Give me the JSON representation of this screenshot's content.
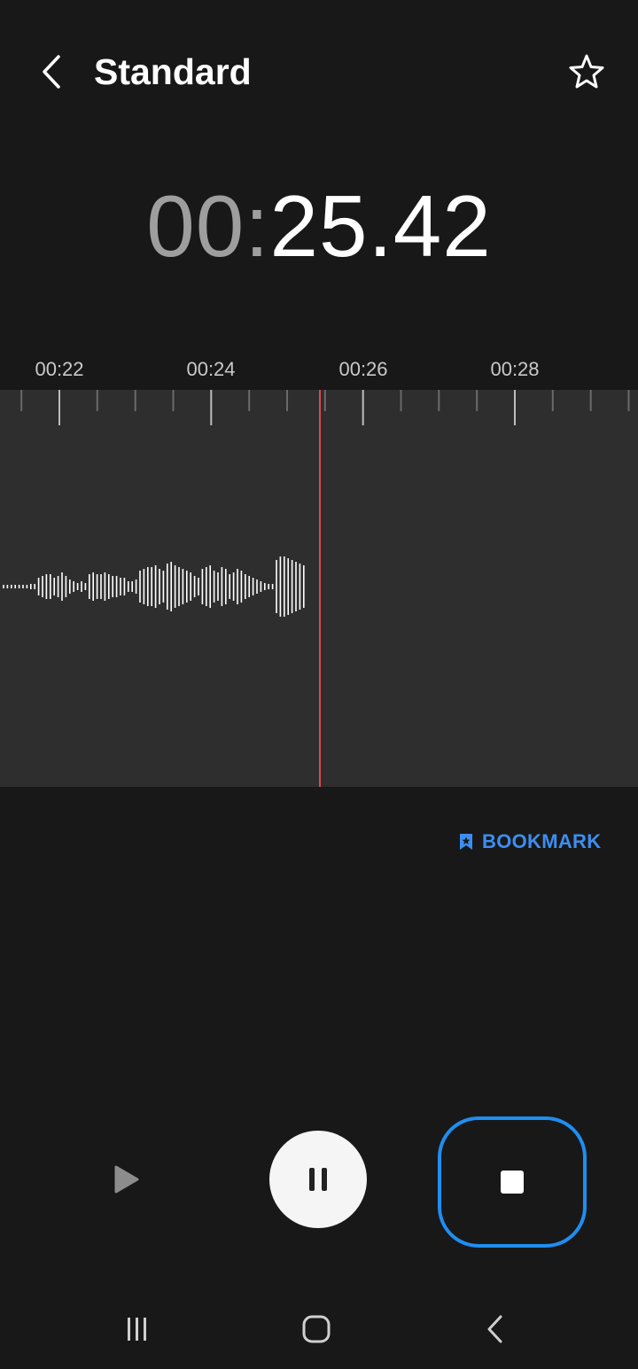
{
  "header": {
    "title": "Standard",
    "back_icon": "chevron-left-icon",
    "favorite_icon": "star-outline-icon"
  },
  "timer": {
    "minutes": "00",
    "separator": ":",
    "seconds": "25.42"
  },
  "timeline": {
    "labels": [
      "00:22",
      "00:24",
      "00:26",
      "00:28"
    ],
    "playhead_color": "#e0484d"
  },
  "bookmark": {
    "label": "BOOKMARK",
    "icon": "bookmark-icon",
    "color": "#3d8ef0"
  },
  "controls": {
    "play_icon": "play-icon",
    "pause_icon": "pause-icon",
    "stop_icon": "stop-icon",
    "stop_accent": "#1f8ef1"
  },
  "system_nav": {
    "recents_icon": "recents-icon",
    "home_icon": "home-icon",
    "back_icon": "back-icon"
  },
  "colors": {
    "background": "#181818",
    "wave_panel": "#2e2e2e"
  }
}
